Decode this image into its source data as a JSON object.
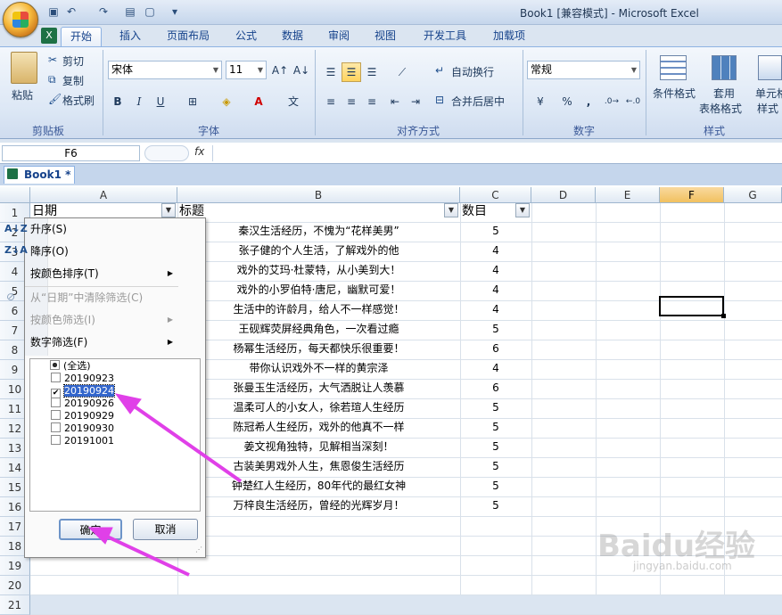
{
  "window": {
    "title": "Book1  [兼容模式] - Microsoft Excel"
  },
  "ribbon": {
    "tabs": [
      "开始",
      "插入",
      "页面布局",
      "公式",
      "数据",
      "审阅",
      "视图",
      "开发工具",
      "加载项"
    ],
    "clipboard": {
      "paste": "粘贴",
      "cut": "剪切",
      "copy": "复制",
      "format_painter": "格式刷",
      "label": "剪贴板"
    },
    "font": {
      "name": "宋体",
      "size": "11",
      "label": "字体",
      "bold": "B",
      "italic": "I",
      "underline": "U",
      "font_color_glyph": "A"
    },
    "alignment": {
      "wrap": "自动换行",
      "merge": "合并后居中",
      "label": "对齐方式"
    },
    "number": {
      "format": "常规",
      "percent": "%",
      "comma": ",",
      "label": "数字"
    },
    "styles": {
      "conditional": "条件格式",
      "table_line1": "套用",
      "table_line2": "表格格式",
      "cell_line1": "单元格",
      "cell_line2": "样式",
      "label": "样式"
    }
  },
  "formula_bar": {
    "name_box": "F6",
    "fx": "fx"
  },
  "workbook_tab": "Book1 *",
  "grid": {
    "columns": [
      "A",
      "B",
      "C",
      "D",
      "E",
      "F",
      "G"
    ],
    "selected_column": "F",
    "rows": [
      "1",
      "2",
      "3",
      "4",
      "5",
      "6",
      "7",
      "8",
      "9",
      "10",
      "11",
      "12",
      "13",
      "14",
      "15",
      "16",
      "17",
      "18",
      "19",
      "20",
      "21"
    ],
    "headers": {
      "a": "日期",
      "b": "标题",
      "c": "数目"
    },
    "data": [
      {
        "title": "秦汉生活经历，不愧为“花样美男”",
        "count": "5"
      },
      {
        "title": "张子健的个人生活，了解戏外的他",
        "count": "4"
      },
      {
        "title": "戏外的艾玛·杜蒙特，从小美到大！",
        "count": "4"
      },
      {
        "title": "戏外的小罗伯特·唐尼，幽默可爱！",
        "count": "4"
      },
      {
        "title": "生活中的许龄月，给人不一样感觉！",
        "count": "4"
      },
      {
        "title": "王砚辉荧屏经典角色，一次看过瘾",
        "count": "5"
      },
      {
        "title": "杨幂生活经历，每天都快乐很重要！",
        "count": "6"
      },
      {
        "title": "带你认识戏外不一样的黄宗泽",
        "count": "4"
      },
      {
        "title": "张曼玉生活经历，大气洒脱让人羡慕",
        "count": "6"
      },
      {
        "title": "温柔可人的小女人，徐若瑄人生经历",
        "count": "5"
      },
      {
        "title": "陈冠希人生经历，戏外的他真不一样",
        "count": "5"
      },
      {
        "title": "姜文视角独特，见解相当深刻！",
        "count": "5"
      },
      {
        "title": "古装美男戏外人生，焦恩俊生活经历",
        "count": "5"
      },
      {
        "title": "钟楚红人生经历，80年代的最红女神",
        "count": "5"
      },
      {
        "title": "万梓良生活经历，曾经的光辉岁月！",
        "count": "5"
      }
    ]
  },
  "filter_menu": {
    "sort_asc": "升序(S)",
    "sort_desc": "降序(O)",
    "sort_color": "按颜色排序(T)",
    "clear_filter": "从“日期”中清除筛选(C)",
    "filter_color": "按颜色筛选(I)",
    "number_filter": "数字筛选(F)",
    "items": [
      {
        "label": "(全选)",
        "state": "partial"
      },
      {
        "label": "20190923",
        "state": "unchecked"
      },
      {
        "label": "20190924",
        "state": "checked"
      },
      {
        "label": "20190926",
        "state": "unchecked"
      },
      {
        "label": "20190929",
        "state": "unchecked"
      },
      {
        "label": "20190930",
        "state": "unchecked"
      },
      {
        "label": "20191001",
        "state": "unchecked"
      }
    ],
    "ok": "确定",
    "cancel": "取消"
  },
  "watermark": {
    "text": "Baidu经验",
    "sub": "jingyan.baidu.com"
  },
  "annotation_color": "#e040e8"
}
